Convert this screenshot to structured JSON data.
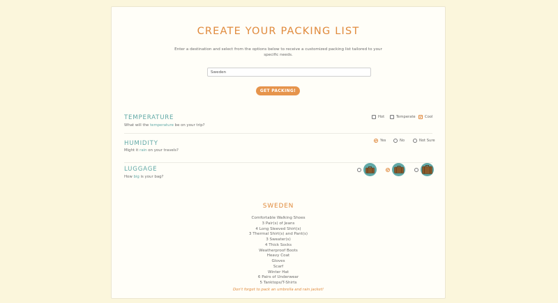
{
  "header": {
    "title": "CREATE YOUR PACKING LIST",
    "intro": "Enter a destination and select from the options below to receive a customized packing list tailored to your specific needs."
  },
  "destination": {
    "value": "Sweden",
    "placeholder": ""
  },
  "submit_label": "GET PACKING!",
  "temperature": {
    "title": "TEMPERATURE",
    "question_pre": "What will the ",
    "question_hl": "temperature",
    "question_post": " be on your trip?",
    "options": [
      {
        "label": "Hot",
        "checked": false
      },
      {
        "label": "Temperate",
        "checked": false
      },
      {
        "label": "Cool",
        "checked": true
      }
    ]
  },
  "humidity": {
    "title": "HUMIDITY",
    "question_pre": "Might it ",
    "question_hl": "rain",
    "question_post": " on your travels?",
    "options": [
      {
        "label": "Yes",
        "checked": true
      },
      {
        "label": "No",
        "checked": false
      },
      {
        "label": "Not Sure",
        "checked": false
      }
    ]
  },
  "luggage": {
    "title": "LUGGAGE",
    "question_pre": "How ",
    "question_hl": "big",
    "question_post": " is your bag?",
    "options": [
      {
        "icon": "small-suitcase-icon",
        "checked": false
      },
      {
        "icon": "medium-suitcase-icon",
        "checked": true
      },
      {
        "icon": "large-suitcase-icon",
        "checked": false
      }
    ]
  },
  "result": {
    "title": "SWEDEN",
    "items": [
      "Comfortable Walking Shoes",
      "3 Pair(s) of Jeans",
      "4 Long Sleeved Shirt(s)",
      "3 Thermal Shirt(s) and Pant(s)",
      "3 Sweater(s)",
      "4 Thick Socks",
      "Weatherproof Boots",
      "Heavy Coat",
      "Gloves",
      "Scarf",
      "Winter Hat",
      "6 Pairs of Underwear",
      "5 Tanktops/T-Shirts"
    ],
    "reminder": "Don't forget to pack an umbrella and rain jacket!"
  },
  "colors": {
    "accent": "#e08a3c",
    "teal": "#5fa8a6",
    "background": "#fbf6dc",
    "card": "#fffef8"
  }
}
